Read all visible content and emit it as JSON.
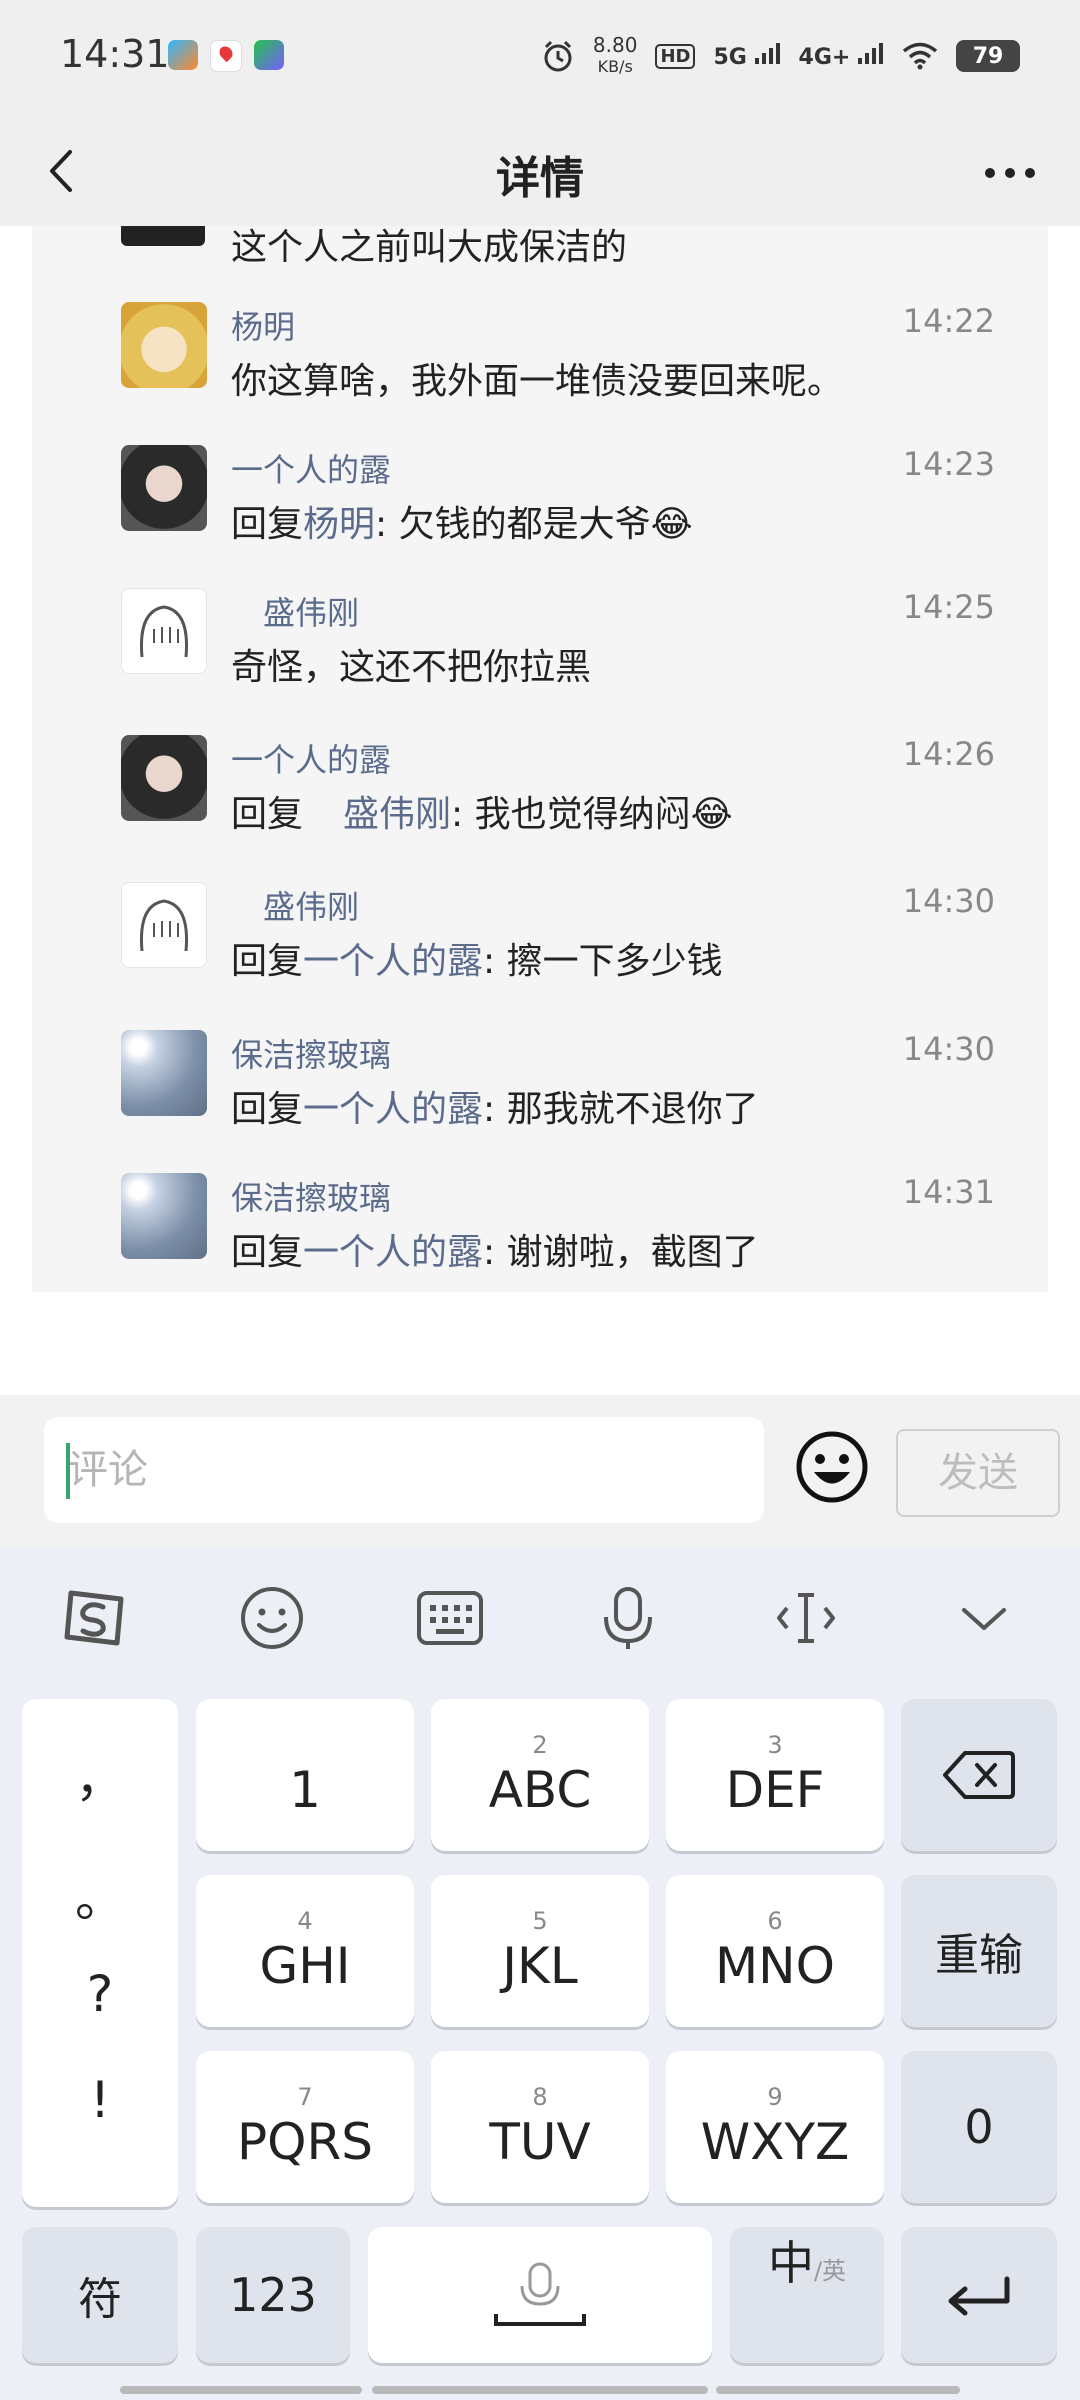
{
  "status_bar": {
    "time": "14:31",
    "net_speed_value": "8.80",
    "net_speed_unit": "KB/s",
    "hd_label": "HD",
    "sig1_label": "5G",
    "sig2_label": "4G+",
    "battery": "79"
  },
  "header": {
    "title": "详情"
  },
  "partial_comment_text": "这个人之前叫大成保洁的",
  "comments": [
    {
      "name": "杨明",
      "time": "14:22",
      "prefix": "",
      "mention": "",
      "text": "你这算啥，我外面一堆债没要回来呢。",
      "emoji": ""
    },
    {
      "name": "一个人的露",
      "time": "14:23",
      "prefix": "回复",
      "mention": "杨明",
      "text": ": 欠钱的都是大爷",
      "emoji": "😂"
    },
    {
      "name": "盛伟刚",
      "time": "14:25",
      "prefix": "",
      "mention": "",
      "text": "奇怪，这还不把你拉黑",
      "emoji": ""
    },
    {
      "name": "一个人的露",
      "time": "14:26",
      "prefix": "回复",
      "mention": "盛伟刚",
      "text": ": 我也觉得纳闷",
      "emoji": "😂"
    },
    {
      "name": "盛伟刚",
      "time": "14:30",
      "prefix": "回复",
      "mention": "一个人的露",
      "text": ": 擦一下多少钱",
      "emoji": ""
    },
    {
      "name": "保洁擦玻璃",
      "time": "14:30",
      "prefix": "回复",
      "mention": "一个人的露",
      "text": ": 那我就不退你了",
      "emoji": ""
    },
    {
      "name": "保洁擦玻璃",
      "time": "14:31",
      "prefix": "回复",
      "mention": "一个人的露",
      "text": ": 谢谢啦，截图了",
      "emoji": ""
    }
  ],
  "input": {
    "placeholder": "评论",
    "send_label": "发送"
  },
  "keyboard": {
    "punctuation": [
      "，",
      "。",
      "?",
      "!"
    ],
    "row1": [
      {
        "sub": "",
        "main": "1"
      },
      {
        "sub": "2",
        "main": "ABC"
      },
      {
        "sub": "3",
        "main": "DEF"
      }
    ],
    "row2": [
      {
        "sub": "4",
        "main": "GHI"
      },
      {
        "sub": "5",
        "main": "JKL"
      },
      {
        "sub": "6",
        "main": "MNO"
      }
    ],
    "row3": [
      {
        "sub": "7",
        "main": "PQRS"
      },
      {
        "sub": "8",
        "main": "TUV"
      },
      {
        "sub": "9",
        "main": "WXYZ"
      }
    ],
    "retype_label": "重输",
    "zero_label": "0",
    "symbols_label": "符",
    "num_label": "123",
    "lang_main": "中",
    "lang_sub": "/英"
  }
}
